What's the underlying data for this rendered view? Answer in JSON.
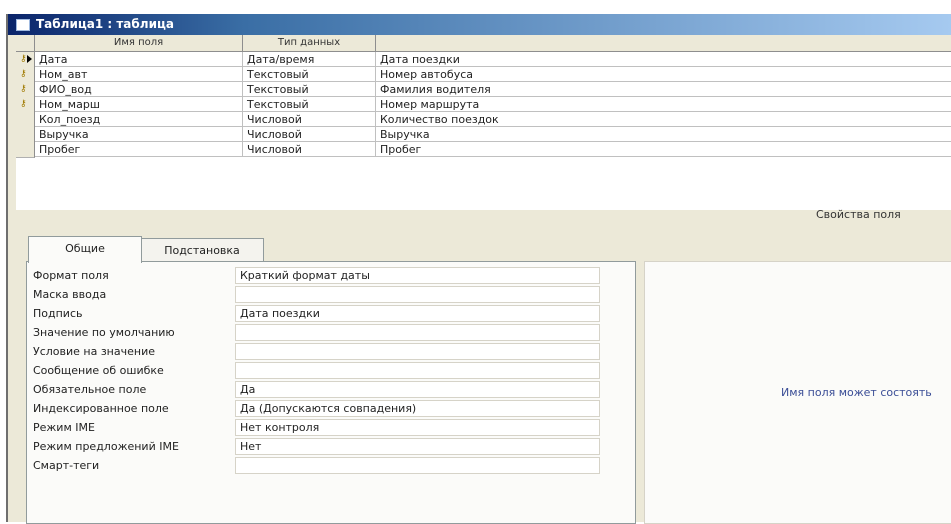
{
  "window": {
    "title": "Таблица1 : таблица"
  },
  "grid": {
    "headers": [
      "Имя поля",
      "Тип данных",
      ""
    ],
    "rows": [
      {
        "name": "Дата",
        "type": "Дата/время",
        "desc": "Дата поездки",
        "key": true,
        "current": true
      },
      {
        "name": "Ном_авт",
        "type": "Текстовый",
        "desc": "Номер автобуса",
        "key": true
      },
      {
        "name": "ФИО_вод",
        "type": "Текстовый",
        "desc": "Фамилия водителя",
        "key": true
      },
      {
        "name": "Ном_марш",
        "type": "Текстовый",
        "desc": "Номер маршрута",
        "key": true
      },
      {
        "name": "Кол_поезд",
        "type": "Числовой",
        "desc": "Количество поездок",
        "key": false
      },
      {
        "name": "Выручка",
        "type": "Числовой",
        "desc": "Выручка",
        "key": false
      },
      {
        "name": "Пробег",
        "type": "Числовой",
        "desc": "Пробег",
        "key": false
      }
    ]
  },
  "field_properties_label": "Свойства поля",
  "tabs": [
    "Общие",
    "Подстановка"
  ],
  "properties": [
    {
      "label": "Формат поля",
      "value": "Краткий формат даты"
    },
    {
      "label": "Маска ввода",
      "value": ""
    },
    {
      "label": "Подпись",
      "value": "Дата поездки"
    },
    {
      "label": "Значение по умолчанию",
      "value": ""
    },
    {
      "label": "Условие на значение",
      "value": ""
    },
    {
      "label": "Сообщение об ошибке",
      "value": ""
    },
    {
      "label": "Обязательное поле",
      "value": "Да"
    },
    {
      "label": "Индексированное поле",
      "value": "Да (Допускаются совпадения)"
    },
    {
      "label": "Режим IME",
      "value": "Нет контроля"
    },
    {
      "label": "Режим предложений IME",
      "value": "Нет"
    },
    {
      "label": "Смарт-теги",
      "value": ""
    }
  ],
  "help_text": "Имя поля может состоять",
  "icons": {
    "key": "key-icon",
    "current_row": "arrow-right-icon"
  }
}
